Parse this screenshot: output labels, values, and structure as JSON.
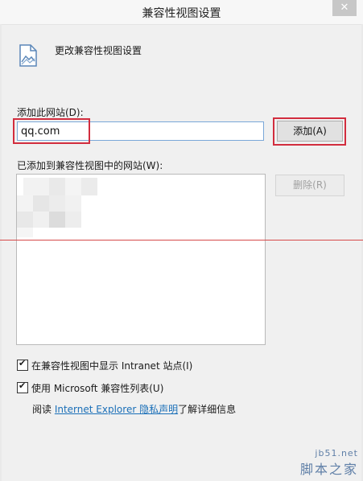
{
  "window": {
    "title": "兼容性视图设置",
    "close_icon": "✕"
  },
  "header": {
    "text": "更改兼容性视图设置",
    "icon": "document-settings-icon"
  },
  "site_field": {
    "label": "添加此网站(D):",
    "value": "qq.com",
    "add_button": "添加(A)"
  },
  "site_list": {
    "label": "已添加到兼容性视图中的网站(W):",
    "remove_button": "删除(R)"
  },
  "options": {
    "show_intranet": {
      "label": "在兼容性视图中显示 Intranet 站点(I)",
      "checked": true
    },
    "use_ms_list": {
      "label": "使用 Microsoft 兼容性列表(U)",
      "checked": true
    }
  },
  "privacy": {
    "prefix": "阅读 ",
    "link": "Internet Explorer 隐私声明",
    "suffix": "了解详细信息"
  },
  "watermark": {
    "url": "jb51.net",
    "name": "脚本之家"
  },
  "colors": {
    "highlight": "#d22d3e",
    "link": "#1a6fb8"
  }
}
